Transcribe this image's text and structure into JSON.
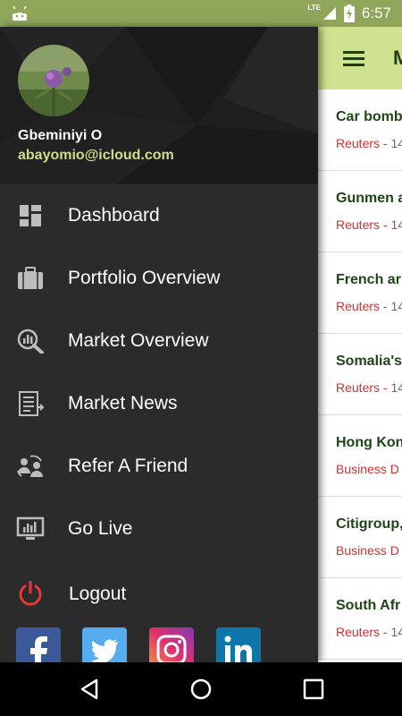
{
  "status_bar": {
    "time": "6:57",
    "network": "LTE",
    "icons": [
      "android-icon",
      "signal-icon",
      "battery-charging-icon"
    ]
  },
  "drawer": {
    "user": {
      "name": "Gbeminiyi O",
      "email": "abayomio@icloud.com"
    },
    "items": [
      {
        "label": "Dashboard",
        "icon": "dashboard-icon"
      },
      {
        "label": "Portfolio Overview",
        "icon": "briefcase-icon"
      },
      {
        "label": "Market Overview",
        "icon": "market-search-icon"
      },
      {
        "label": "Market News",
        "icon": "news-icon"
      },
      {
        "label": "Refer A Friend",
        "icon": "refer-icon"
      },
      {
        "label": "Go Live",
        "icon": "monitor-icon"
      },
      {
        "label": "Logout",
        "icon": "power-icon"
      }
    ],
    "social": [
      "facebook-icon",
      "twitter-icon",
      "instagram-icon",
      "linkedin-icon"
    ]
  },
  "app": {
    "news": [
      {
        "title": "Car bomb",
        "source": "Reuters - ",
        "time": "14"
      },
      {
        "title": "Gunmen a",
        "source": "Reuters - ",
        "time": "14"
      },
      {
        "title": "French ar",
        "source": "Reuters - ",
        "time": "14"
      },
      {
        "title": "Somalia's",
        "source": "Reuters - ",
        "time": "14"
      },
      {
        "title": "Hong Kon",
        "source": "Business D",
        "time": ""
      },
      {
        "title": "Citigroup,",
        "source": "Business D",
        "time": ""
      },
      {
        "title": "South Afr",
        "source": "Reuters - ",
        "time": "14"
      }
    ]
  },
  "colors": {
    "status_bar": "#8fa65a",
    "toolbar": "#cfe28f",
    "drawer": "#2b2b2b",
    "accent_email": "#c9df8a",
    "news_source": "#d32f2f",
    "news_title": "#1e4616"
  }
}
